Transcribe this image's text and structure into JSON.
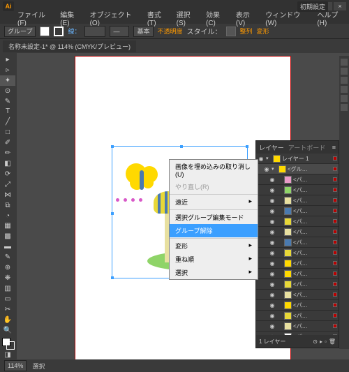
{
  "app": {
    "badge": "Ai",
    "wintools": "初期設定"
  },
  "menubar": [
    "ファイル(F)",
    "編集(E)",
    "オブジェクト(O)",
    "書式(T)",
    "選択(S)",
    "効果(C)",
    "表示(V)",
    "ウィンドウ(W)",
    "ヘルプ(H)"
  ],
  "ctrl": {
    "object": "グループ",
    "stroke_label": "線：",
    "stroke_val": "",
    "basic": "基本",
    "opacity_label": "不透明度",
    "style_label": "スタイル：",
    "align": "整列",
    "transform": "変形"
  },
  "tab": "名称未設定-1* @ 114% (CMYK/プレビュー)",
  "contextmenu": [
    {
      "label": "画像を埋め込みの取り消し(U)",
      "disabled": false,
      "sep": false
    },
    {
      "label": "やり直し(R)",
      "disabled": true,
      "sep": false
    },
    {
      "label": "",
      "sep": true
    },
    {
      "label": "遠近",
      "disabled": false,
      "sub": true,
      "sep": false
    },
    {
      "label": "",
      "sep": true
    },
    {
      "label": "選択グループ編集モード",
      "disabled": false,
      "sep": false
    },
    {
      "label": "グループ解除",
      "disabled": false,
      "highlight": true,
      "sep": false
    },
    {
      "label": "",
      "sep": true
    },
    {
      "label": "変形",
      "disabled": false,
      "sub": true,
      "sep": false
    },
    {
      "label": "重ね順",
      "disabled": false,
      "sub": true,
      "sep": false
    },
    {
      "label": "選択",
      "disabled": false,
      "sub": true,
      "sep": false
    }
  ],
  "panel": {
    "tabs": [
      "レイヤー",
      "アートボード"
    ],
    "root": "レイヤー 1",
    "group": "<グル…",
    "sublayers": [
      "<パ…",
      "<パ…",
      "<パ…",
      "<パ…",
      "<パ…",
      "<パ…",
      "<パ…",
      "<パ…",
      "<パ…",
      "<パ…",
      "<パ…",
      "<パ…",
      "<パ…",
      "<パ…",
      "<パ…",
      "<パ…"
    ],
    "thumb_colors": [
      "#e89ac8",
      "#8fd468",
      "#e8e0a0",
      "#4a7ab0",
      "#e8d838",
      "#e8e0a0",
      "#4a7ab0",
      "#e8d838",
      "#ffd900",
      "#ffd900",
      "#e8d838",
      "#e8e0a0",
      "#ffd900",
      "#e8d838",
      "#e8e0a0",
      "#fff"
    ],
    "footer": "1 レイヤー"
  },
  "status": {
    "zoom": "114%",
    "tool": "選択"
  }
}
